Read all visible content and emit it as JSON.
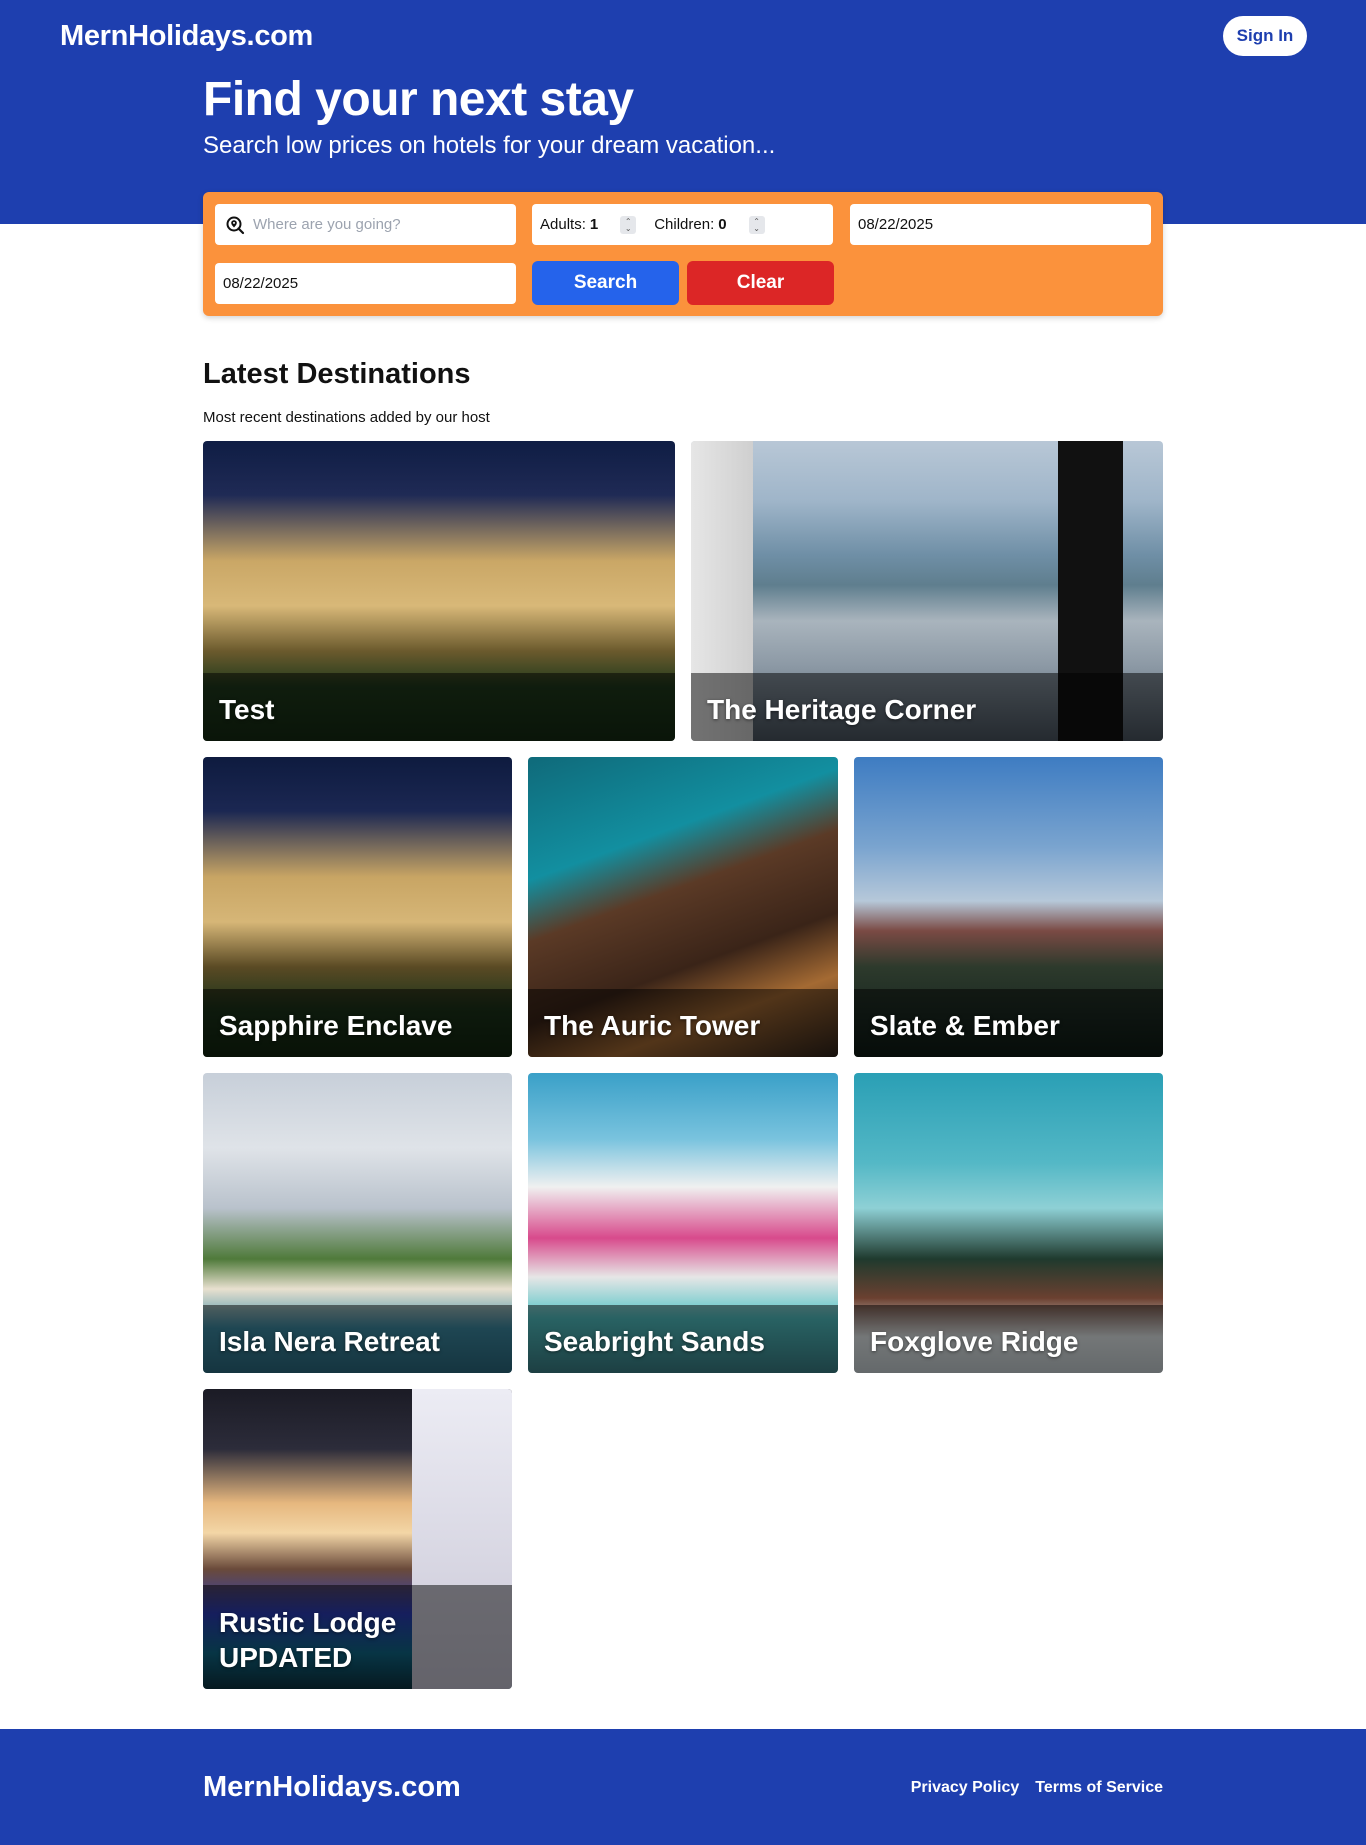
{
  "header": {
    "logo": "MernHolidays.com",
    "sign_in_label": "Sign In",
    "hero_title": "Find your next stay",
    "hero_subtitle": "Search low prices on hotels for your dream vacation..."
  },
  "search": {
    "destination_placeholder": "Where are you going?",
    "destination_icon": "location-search-icon",
    "adults_label": "Adults:",
    "adults_value": "1",
    "children_label": "Children:",
    "children_value": "0",
    "check_in": "08/22/2025",
    "check_out": "08/22/2025",
    "search_label": "Search",
    "clear_label": "Clear"
  },
  "destinations": {
    "title": "Latest Destinations",
    "subtitle": "Most recent destinations added by our host",
    "cards": [
      {
        "name": "Test"
      },
      {
        "name": "The Heritage Corner"
      },
      {
        "name": "Sapphire Enclave"
      },
      {
        "name": "The Auric Tower"
      },
      {
        "name": "Slate & Ember"
      },
      {
        "name": "Isla Nera Retreat"
      },
      {
        "name": "Seabright Sands"
      },
      {
        "name": "Foxglove Ridge"
      },
      {
        "name": "Rustic Lodge UPDATED"
      }
    ]
  },
  "footer": {
    "logo": "MernHolidays.com",
    "privacy_label": "Privacy Policy",
    "terms_label": "Terms of Service"
  },
  "colors": {
    "brand_blue": "#1e3faf",
    "search_orange": "#fb923c",
    "search_button": "#2563eb",
    "clear_button": "#dc2626"
  }
}
